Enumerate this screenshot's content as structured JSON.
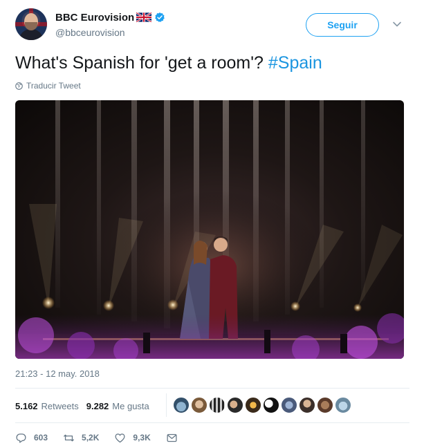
{
  "author": {
    "display_name": "BBC Eurovision",
    "handle": "@bbceurovision",
    "flag_icon": "uk-flag-icon",
    "verified_icon": "verified-badge-icon",
    "verified_color": "#1da1f2"
  },
  "follow": {
    "label": "Seguir",
    "menu_icon": "chevron-down-icon"
  },
  "tweet": {
    "text": "What's Spanish for 'get a room'? ",
    "hashtag": "#Spain",
    "hashtag_color": "#1b95e0"
  },
  "translate": {
    "label": "Traducir Tweet",
    "icon": "globe-icon"
  },
  "media": {
    "description_icon": "photo-stage-performance"
  },
  "timestamp": "21:23 - 12 may. 2018",
  "stats": {
    "retweets_count": "5.162",
    "retweets_label": "Retweets",
    "likes_count": "9.282",
    "likes_label": "Me gusta",
    "liker_avatar_count_shown": 10
  },
  "actions": {
    "reply_count": "603",
    "retweet_count": "5,2K",
    "like_count": "9,3K",
    "icons": [
      "reply-icon",
      "retweet-icon",
      "heart-icon",
      "message-icon"
    ]
  },
  "colors": {
    "text_primary": "#14171a",
    "text_secondary": "#657786",
    "accent": "#1da1f2",
    "divider": "#e6ecf0"
  }
}
